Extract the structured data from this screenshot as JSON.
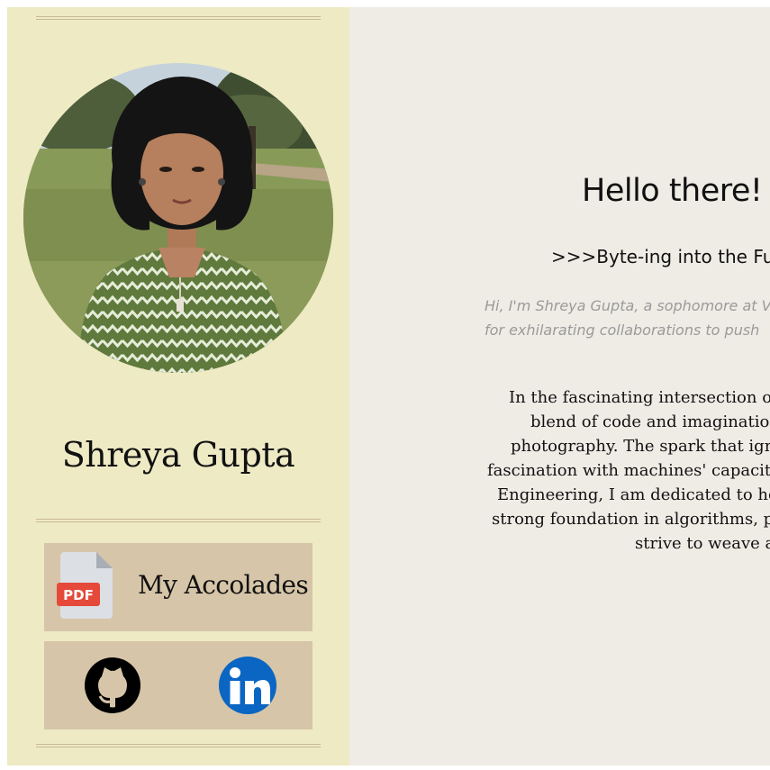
{
  "sidebar": {
    "photo": {
      "alt": "Shreya Gupta"
    },
    "name": "Shreya Gupta",
    "accolades": {
      "label": "My Accolades",
      "icon": "pdf-file-icon",
      "badge": "PDF"
    },
    "social_links": [
      {
        "name": "GitHub",
        "icon": "github-icon"
      },
      {
        "name": "LinkedIn",
        "icon": "linkedin-icon"
      }
    ]
  },
  "main": {
    "greeting": "Hello there! I'",
    "tagline": ">>>Byte-ing into the Futu",
    "intro_lines": [
      "Hi, I'm Shreya Gupta, a sophomore at V",
      " for exhilarating collaborations to push "
    ],
    "bio_lines": [
      "In the fascinating intersection of",
      "blend of code and imagination",
      "photography. The spark that igni",
      "fascination with machines' capacity",
      "Engineering, I am dedicated to hon",
      "strong foundation in algorithms, pr",
      "strive to weave a "
    ]
  },
  "colors": {
    "sidebar_bg": "#eeeac4",
    "main_bg": "#efece6",
    "button_bg": "#d6c5a8",
    "rule": "#c9b896",
    "linkedin": "#0a66c2",
    "pdf_red": "#e5493a"
  }
}
